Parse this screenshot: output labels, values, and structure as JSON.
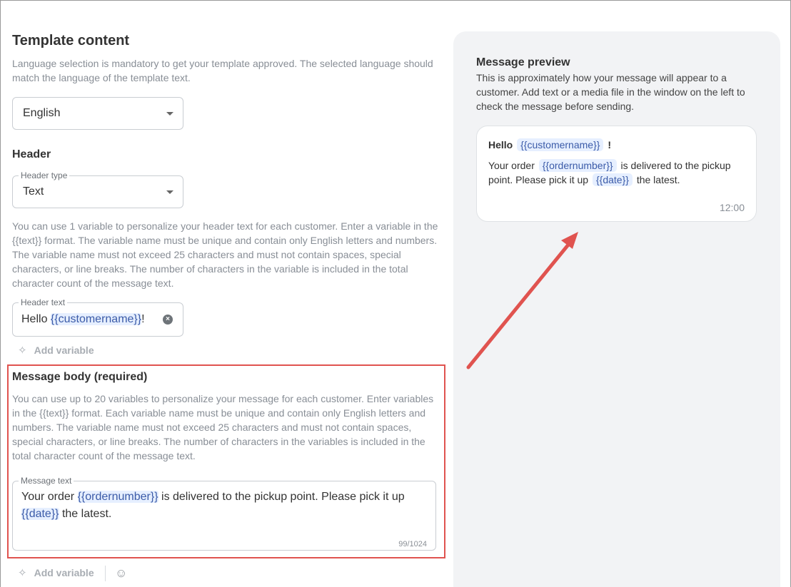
{
  "template": {
    "title": "Template content",
    "language_note": "Language selection is mandatory to get your template approved. The selected language should match the language of the template text.",
    "language": {
      "value": "English"
    }
  },
  "header": {
    "title": "Header",
    "type_label": "Header type",
    "type_value": "Text",
    "note": "You can use 1 variable to personalize your header text for each customer. Enter a variable in the {{text}} format. The variable name must be unique and contain only English letters and numbers. The variable name must not exceed 25 characters and must not contain spaces, special characters, or line breaks. The number of characters in the variable is included in the total character count of the message text.",
    "text_label": "Header text",
    "text_prefix": "Hello ",
    "text_var": "{{customername}}",
    "text_suffix": "!",
    "add_variable": "Add variable"
  },
  "body": {
    "title": "Message body (required)",
    "note": "You can use up to 20 variables to personalize your message for each customer. Enter variables in the {{text}} format. Each variable name must be unique and contain only English letters and numbers. The variable name must not exceed 25 characters and must not contain spaces, special characters, or line breaks. The number of characters in the variables is included in the total character count of the message text.",
    "text_label": "Message text",
    "text_part1": "Your order ",
    "text_var1": "{{ordernumber}}",
    "text_part2": " is delivered to the pickup point. Please pick it up ",
    "text_var2": "{{date}}",
    "text_part3": " the latest.",
    "counter": "99/1024",
    "add_variable": "Add variable"
  },
  "preview": {
    "title": "Message preview",
    "note": "This is approximately how your message will appear to a customer. Add text or a media file in the window on the left to check the message before sending.",
    "head_prefix": "Hello",
    "head_var": "{{customername}}",
    "head_suffix": "!",
    "body_part1": "Your order",
    "body_var1": "{{ordernumber}}",
    "body_part2": "is delivered to the pickup point. Please pick it up",
    "body_var2": "{{date}}",
    "body_part3": "the latest.",
    "time": "12:00"
  },
  "colors": {
    "highlight": "#e0534f",
    "variable_bg": "#e6efff",
    "panel_bg": "#f2f3f5"
  }
}
